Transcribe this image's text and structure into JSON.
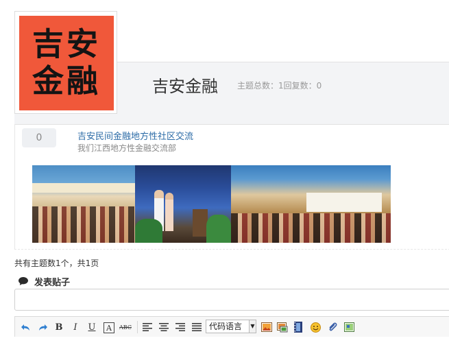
{
  "forum": {
    "logo_text": "吉安\n金融",
    "title": "吉安金融",
    "stats": "主题总数：1回复数：0"
  },
  "thread": {
    "reply_count": "0",
    "title": "吉安民间金融地方性社区交流",
    "description": "我们江西地方性金融交流部"
  },
  "pager": {
    "text": "共有主题数1个，共1页"
  },
  "post": {
    "heading": "发表贴子",
    "title_value": ""
  },
  "toolbar": {
    "bold": "B",
    "italic": "I",
    "underline": "U",
    "font_color": "A",
    "strike": "ABC",
    "code_language": "代码语言",
    "icons": [
      "undo-icon",
      "redo-icon",
      "bold-icon",
      "italic-icon",
      "underline-icon",
      "font-color-icon",
      "strikethrough-icon",
      "align-left-icon",
      "align-center-icon",
      "align-right-icon",
      "justify-icon",
      "code-language-select",
      "insert-image-icon",
      "insert-photo-icon",
      "insert-video-icon",
      "emoticon-icon",
      "attachment-icon",
      "insert-table-icon"
    ]
  },
  "colors": {
    "logo_bg": "#f0583a",
    "link": "#2a6aa6",
    "header_band": "#f3f4f6"
  }
}
